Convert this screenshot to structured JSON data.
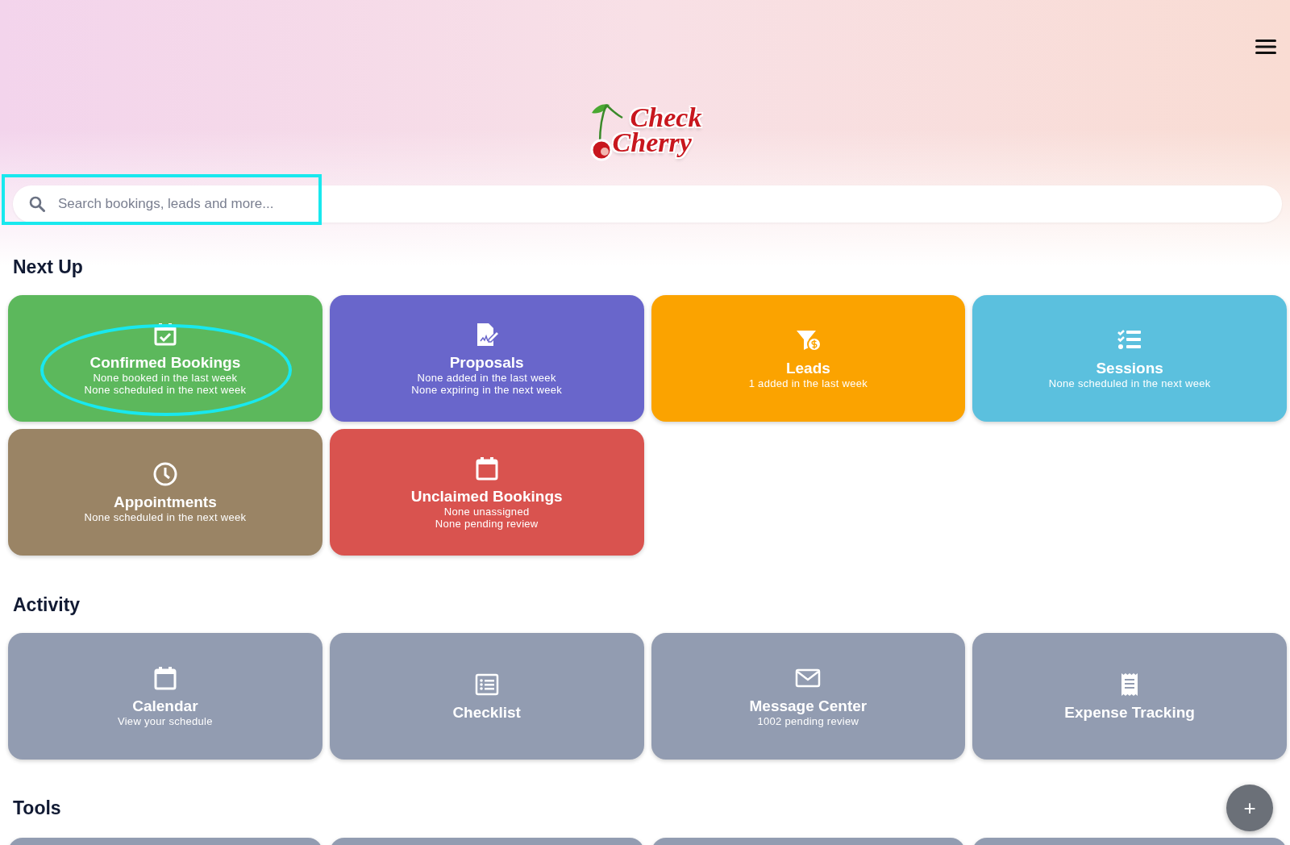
{
  "logo": {
    "line_1": "Check",
    "line_2": "Cherry"
  },
  "search": {
    "placeholder": "Search bookings, leads and more..."
  },
  "next_up": {
    "title": "Next Up",
    "cards": [
      {
        "title": "Confirmed Bookings",
        "lines": [
          "None booked in the last week",
          "None scheduled in the next week"
        ],
        "color": "#5cb85c"
      },
      {
        "title": "Proposals",
        "lines": [
          "None added in the last week",
          "None expiring in the next week"
        ],
        "color": "#6966cb"
      },
      {
        "title": "Leads",
        "lines": [
          "1 added in the last week"
        ],
        "color": "#fba300"
      },
      {
        "title": "Sessions",
        "lines": [
          "None scheduled in the next week"
        ],
        "color": "#5bc0de"
      },
      {
        "title": "Appointments",
        "lines": [
          "None scheduled in the next week"
        ],
        "color": "#9a8465"
      },
      {
        "title": "Unclaimed Bookings",
        "lines": [
          "None unassigned",
          "None pending review"
        ],
        "color": "#d9534f"
      }
    ]
  },
  "activity": {
    "title": "Activity",
    "cards": [
      {
        "title": "Calendar",
        "lines": [
          "View your schedule"
        ]
      },
      {
        "title": "Checklist"
      },
      {
        "title": "Message Center",
        "lines": [
          "1002 pending review"
        ]
      },
      {
        "title": "Expense Tracking"
      }
    ]
  },
  "tools": {
    "title": "Tools",
    "cards": [
      {
        "kind": "blank"
      },
      {
        "kind": "blank"
      },
      {
        "kind": "blank"
      },
      {
        "kind": "blank"
      }
    ]
  },
  "annotations": [
    {
      "kind": "rectangle"
    },
    {
      "kind": "ellipse"
    }
  ],
  "fab": {
    "label": "+"
  }
}
